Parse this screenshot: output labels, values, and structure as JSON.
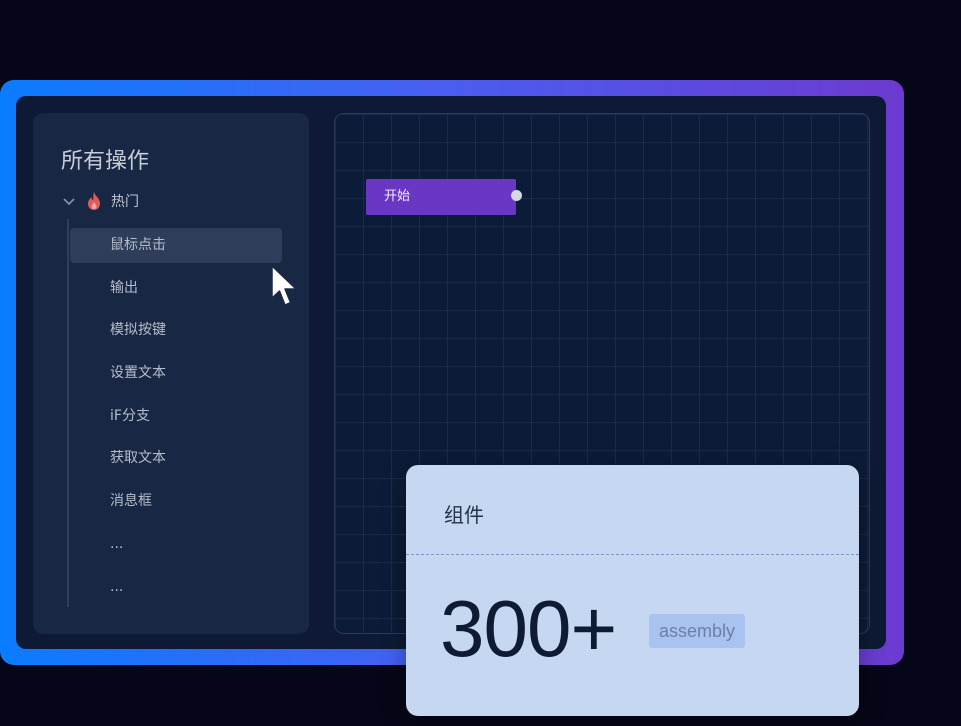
{
  "sidebar": {
    "title": "所有操作",
    "group": {
      "label": "热门",
      "icon": "fire-icon",
      "expanded": true
    },
    "items": [
      {
        "label": "鼠标点击",
        "active": true
      },
      {
        "label": "输出"
      },
      {
        "label": "模拟按键"
      },
      {
        "label": "设置文本"
      },
      {
        "label": "iF分支"
      },
      {
        "label": "获取文本"
      },
      {
        "label": "消息框"
      },
      {
        "label": "..."
      },
      {
        "label": "..."
      }
    ]
  },
  "canvas": {
    "start_node": {
      "label": "开始"
    }
  },
  "card": {
    "title": "组件",
    "count": "300+",
    "badge": "assembly"
  },
  "colors": {
    "gradient_start": "#0a7cff",
    "gradient_end": "#6d3ad0",
    "node": "#6a37c4",
    "card": "#c5d7f1"
  }
}
